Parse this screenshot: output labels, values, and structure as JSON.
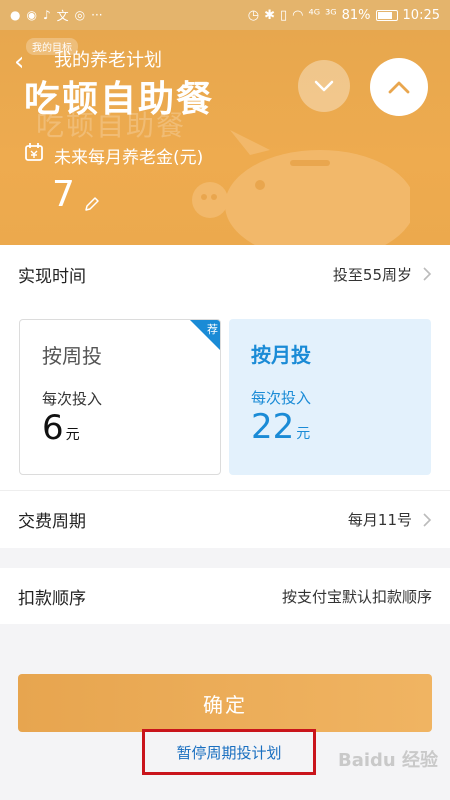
{
  "status_bar": {
    "signal_4g": "⁴ᴳ",
    "signal_3g": "³ᴳ",
    "battery": "81%",
    "time": "10:25"
  },
  "header": {
    "tag": "我的目标",
    "nav_title": "我的养老计划",
    "big_title": "吃顿自助餐",
    "ghost_text": "吃顿自助餐",
    "pension_label": "未来每月养老金(元)",
    "pension_value": "7"
  },
  "rows": {
    "time_label": "实现时间",
    "time_value": "投至55周岁",
    "period_label": "交费周期",
    "period_value": "每月11号",
    "order_label": "扣款顺序",
    "order_value": "按支付宝默认扣款顺序"
  },
  "cards": {
    "weekly": {
      "title": "按周投",
      "sub": "每次投入",
      "amount": "6",
      "unit": "元",
      "badge": "荐"
    },
    "monthly": {
      "title": "按月投",
      "sub": "每次投入",
      "amount": "22",
      "unit": "元"
    }
  },
  "actions": {
    "confirm": "确定",
    "pause": "暂停周期投计划"
  },
  "watermark": "Baidu 经验",
  "colors": {
    "accent": "#eca94d",
    "blue": "#1a8bd6",
    "highlight_border": "#c9141b"
  }
}
